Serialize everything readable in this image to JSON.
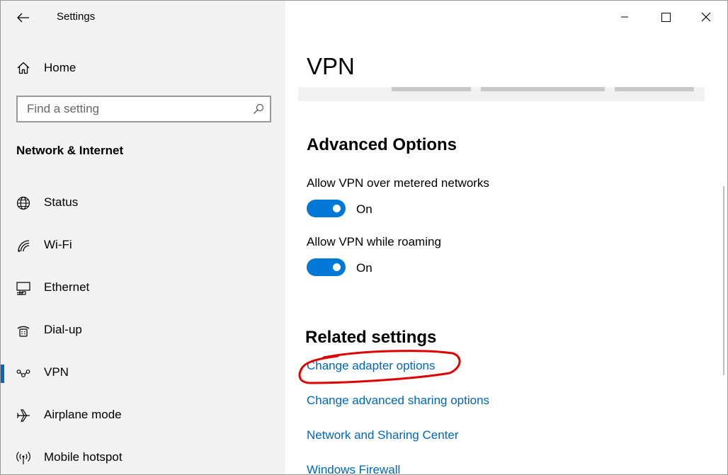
{
  "window": {
    "title": "Settings",
    "controls": {
      "minimize": "minimize-icon",
      "maximize": "maximize-icon",
      "close": "close-icon"
    }
  },
  "sidebar": {
    "home_label": "Home",
    "search": {
      "placeholder": "Find a setting",
      "value": ""
    },
    "section_title": "Network & Internet",
    "items": [
      {
        "label": "Status",
        "icon": "globe-icon",
        "selected": false
      },
      {
        "label": "Wi-Fi",
        "icon": "wifi-icon",
        "selected": false
      },
      {
        "label": "Ethernet",
        "icon": "ethernet-icon",
        "selected": false
      },
      {
        "label": "Dial-up",
        "icon": "dialup-icon",
        "selected": false
      },
      {
        "label": "VPN",
        "icon": "vpn-icon",
        "selected": true
      },
      {
        "label": "Airplane mode",
        "icon": "airplane-icon",
        "selected": false
      },
      {
        "label": "Mobile hotspot",
        "icon": "hotspot-icon",
        "selected": false
      }
    ]
  },
  "main": {
    "title": "VPN",
    "advanced": {
      "title": "Advanced Options",
      "options": [
        {
          "label": "Allow VPN over metered networks",
          "state": "On"
        },
        {
          "label": "Allow VPN while roaming",
          "state": "On"
        }
      ]
    },
    "related": {
      "title": "Related settings",
      "links": [
        "Change adapter options",
        "Change advanced sharing options",
        "Network and Sharing Center",
        "Windows Firewall"
      ]
    }
  },
  "colors": {
    "accent": "#0078d7",
    "link": "#0067b8",
    "sidebar_bg": "#f2f2f2",
    "annotation": "#e00000"
  }
}
